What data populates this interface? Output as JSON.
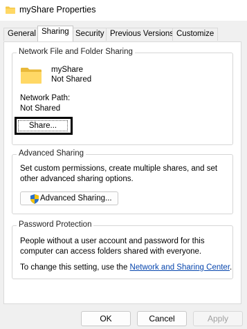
{
  "window": {
    "title": "myShare Properties",
    "icon": "folder-icon"
  },
  "tabs": [
    {
      "label": "General",
      "active": false
    },
    {
      "label": "Sharing",
      "active": true
    },
    {
      "label": "Security",
      "active": false
    },
    {
      "label": "Previous Versions",
      "active": false
    },
    {
      "label": "Customize",
      "active": false
    }
  ],
  "network_sharing": {
    "group_title": "Network File and Folder Sharing",
    "folder_name": "myShare",
    "folder_status": "Not Shared",
    "path_label": "Network Path:",
    "path_value": "Not Shared",
    "share_button": "Share..."
  },
  "advanced_sharing": {
    "group_title": "Advanced Sharing",
    "description": "Set custom permissions, create multiple shares, and set other advanced sharing options.",
    "button": "Advanced Sharing...",
    "button_icon": "shield-icon"
  },
  "password_protection": {
    "group_title": "Password Protection",
    "description": "People without a user account and password for this computer can access folders shared with everyone.",
    "change_prefix": "To change this setting, use the ",
    "link": "Network and Sharing Center",
    "change_suffix": "."
  },
  "footer": {
    "ok": "OK",
    "cancel": "Cancel",
    "apply": "Apply",
    "apply_enabled": false
  },
  "colors": {
    "folder": "#f4c84a",
    "link": "#0645ad",
    "highlight_border": "#000000"
  }
}
